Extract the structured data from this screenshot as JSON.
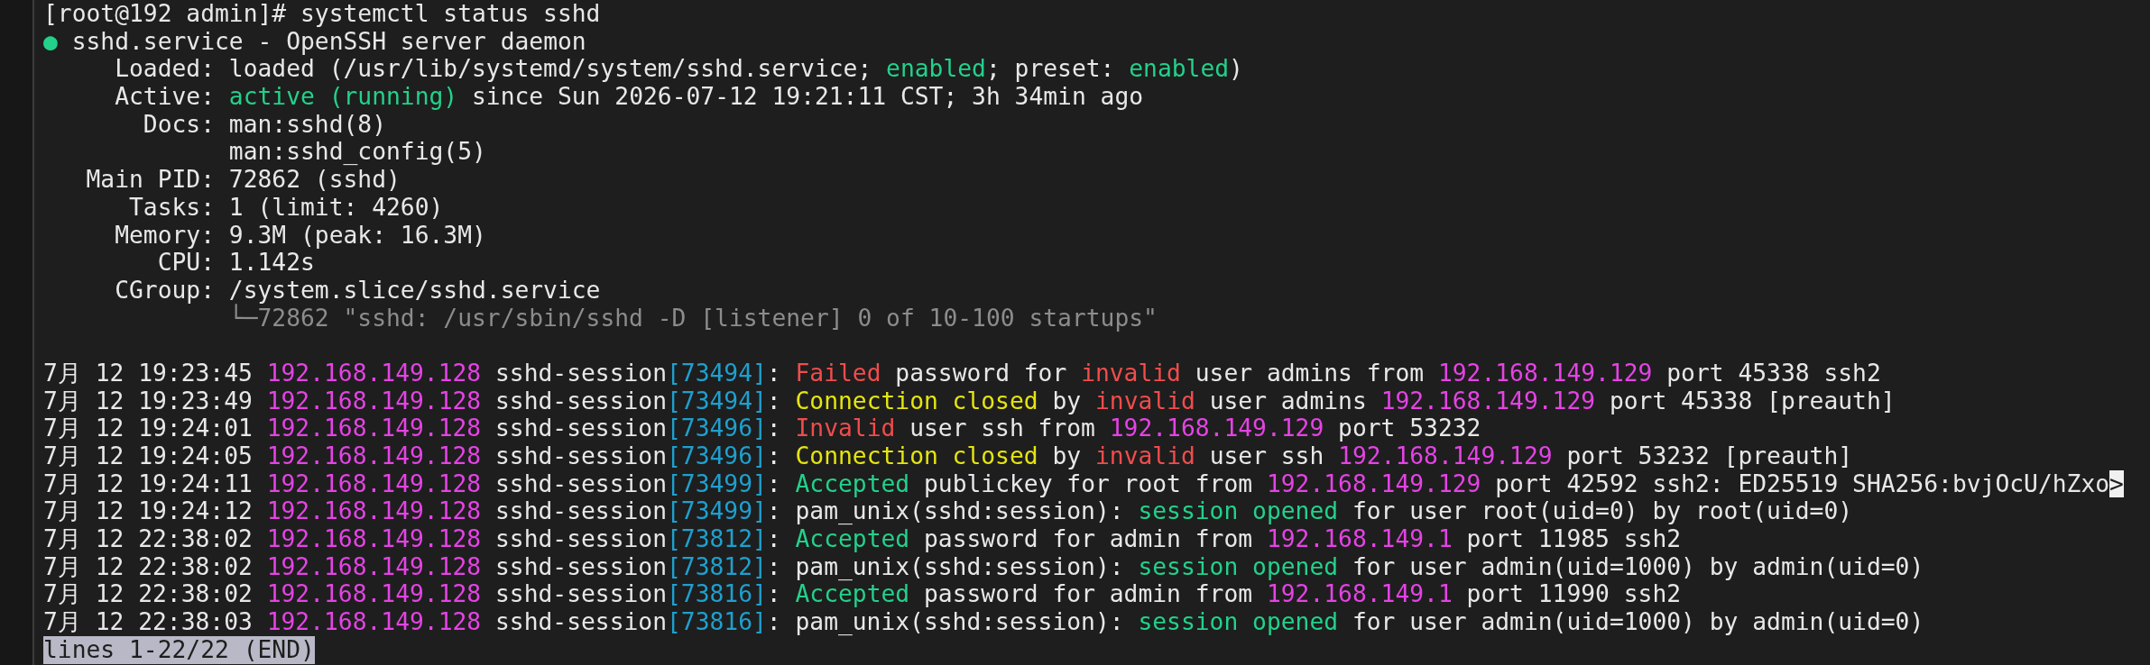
{
  "terminal": {
    "lines": [
      [
        {
          "text": "[root@192 admin]# systemctl status sshd",
          "kind": "plain"
        }
      ],
      [
        {
          "text": "●",
          "kind": "ok"
        },
        {
          "text": " sshd.service - OpenSSH server daemon",
          "kind": "plain"
        }
      ],
      [
        {
          "text": "     Loaded: loaded (/usr/lib/systemd/system/sshd.service; ",
          "kind": "plain"
        },
        {
          "text": "enabled",
          "kind": "ok"
        },
        {
          "text": "; preset: ",
          "kind": "plain"
        },
        {
          "text": "enabled",
          "kind": "ok"
        },
        {
          "text": ")",
          "kind": "plain"
        }
      ],
      [
        {
          "text": "     Active: ",
          "kind": "plain"
        },
        {
          "text": "active (running)",
          "kind": "ok"
        },
        {
          "text": " since Sun 2026-07-12 19:21:11 CST; 3h 34min ago",
          "kind": "plain"
        }
      ],
      [
        {
          "text": "       Docs: man:sshd(8)",
          "kind": "plain"
        }
      ],
      [
        {
          "text": "             man:sshd_config(5)",
          "kind": "plain"
        }
      ],
      [
        {
          "text": "   Main PID: 72862 (sshd)",
          "kind": "plain"
        }
      ],
      [
        {
          "text": "      Tasks: 1 (limit: 4260)",
          "kind": "plain"
        }
      ],
      [
        {
          "text": "     Memory: 9.3M (peak: 16.3M)",
          "kind": "plain"
        }
      ],
      [
        {
          "text": "        CPU: 1.142s",
          "kind": "plain"
        }
      ],
      [
        {
          "text": "     CGroup: /system.slice/sshd.service",
          "kind": "plain"
        }
      ],
      [
        {
          "text": "             └─72862 \"sshd: /usr/sbin/sshd -D [listener] 0 of 10-100 startups\"",
          "kind": "dim"
        }
      ]
    ],
    "journal": [
      [
        {
          "text": "7月 12 19:23:45 ",
          "kind": "plain"
        },
        {
          "text": "192.168.149.128",
          "kind": "address"
        },
        {
          "text": " sshd-session",
          "kind": "plain"
        },
        {
          "text": "[73494]",
          "kind": "pid"
        },
        {
          "text": ": ",
          "kind": "plain"
        },
        {
          "text": "Failed",
          "kind": "error"
        },
        {
          "text": " password for ",
          "kind": "plain"
        },
        {
          "text": "invalid",
          "kind": "error"
        },
        {
          "text": " user admins from ",
          "kind": "plain"
        },
        {
          "text": "192.168.149.129",
          "kind": "address"
        },
        {
          "text": " port 45338 ssh2",
          "kind": "plain"
        }
      ],
      [
        {
          "text": "7月 12 19:23:49 ",
          "kind": "plain"
        },
        {
          "text": "192.168.149.128",
          "kind": "address"
        },
        {
          "text": " sshd-session",
          "kind": "plain"
        },
        {
          "text": "[73494]",
          "kind": "pid"
        },
        {
          "text": ": ",
          "kind": "plain"
        },
        {
          "text": "Connection closed",
          "kind": "warn"
        },
        {
          "text": " by ",
          "kind": "plain"
        },
        {
          "text": "invalid",
          "kind": "error"
        },
        {
          "text": " user admins ",
          "kind": "plain"
        },
        {
          "text": "192.168.149.129",
          "kind": "address"
        },
        {
          "text": " port 45338 [preauth]",
          "kind": "plain"
        }
      ],
      [
        {
          "text": "7月 12 19:24:01 ",
          "kind": "plain"
        },
        {
          "text": "192.168.149.128",
          "kind": "address"
        },
        {
          "text": " sshd-session",
          "kind": "plain"
        },
        {
          "text": "[73496]",
          "kind": "pid"
        },
        {
          "text": ": ",
          "kind": "plain"
        },
        {
          "text": "Invalid",
          "kind": "error"
        },
        {
          "text": " user ssh from ",
          "kind": "plain"
        },
        {
          "text": "192.168.149.129",
          "kind": "address"
        },
        {
          "text": " port 53232",
          "kind": "plain"
        }
      ],
      [
        {
          "text": "7月 12 19:24:05 ",
          "kind": "plain"
        },
        {
          "text": "192.168.149.128",
          "kind": "address"
        },
        {
          "text": " sshd-session",
          "kind": "plain"
        },
        {
          "text": "[73496]",
          "kind": "pid"
        },
        {
          "text": ": ",
          "kind": "plain"
        },
        {
          "text": "Connection closed",
          "kind": "warn"
        },
        {
          "text": " by ",
          "kind": "plain"
        },
        {
          "text": "invalid",
          "kind": "error"
        },
        {
          "text": " user ssh ",
          "kind": "plain"
        },
        {
          "text": "192.168.149.129",
          "kind": "address"
        },
        {
          "text": " port 53232 [preauth]",
          "kind": "plain"
        }
      ],
      [
        {
          "text": "7月 12 19:24:11 ",
          "kind": "plain"
        },
        {
          "text": "192.168.149.128",
          "kind": "address"
        },
        {
          "text": " sshd-session",
          "kind": "plain"
        },
        {
          "text": "[73499]",
          "kind": "pid"
        },
        {
          "text": ": ",
          "kind": "plain"
        },
        {
          "text": "Accepted",
          "kind": "ok"
        },
        {
          "text": " publickey for root from ",
          "kind": "plain"
        },
        {
          "text": "192.168.149.129",
          "kind": "address"
        },
        {
          "text": " port 42592 ssh2: ED25519 SHA256:bvjOcU/hZxo",
          "kind": "plain"
        },
        {
          "text": ">",
          "kind": "reverse"
        }
      ],
      [
        {
          "text": "7月 12 19:24:12 ",
          "kind": "plain"
        },
        {
          "text": "192.168.149.128",
          "kind": "address"
        },
        {
          "text": " sshd-session",
          "kind": "plain"
        },
        {
          "text": "[73499]",
          "kind": "pid"
        },
        {
          "text": ": pam_unix(sshd:session): ",
          "kind": "plain"
        },
        {
          "text": "session opened",
          "kind": "ok"
        },
        {
          "text": " for user root(uid=0) by root(uid=0)",
          "kind": "plain"
        }
      ],
      [
        {
          "text": "7月 12 22:38:02 ",
          "kind": "plain"
        },
        {
          "text": "192.168.149.128",
          "kind": "address"
        },
        {
          "text": " sshd-session",
          "kind": "plain"
        },
        {
          "text": "[73812]",
          "kind": "pid"
        },
        {
          "text": ": ",
          "kind": "plain"
        },
        {
          "text": "Accepted",
          "kind": "ok"
        },
        {
          "text": " password for admin from ",
          "kind": "plain"
        },
        {
          "text": "192.168.149.1",
          "kind": "address"
        },
        {
          "text": " port 11985 ssh2",
          "kind": "plain"
        }
      ],
      [
        {
          "text": "7月 12 22:38:02 ",
          "kind": "plain"
        },
        {
          "text": "192.168.149.128",
          "kind": "address"
        },
        {
          "text": " sshd-session",
          "kind": "plain"
        },
        {
          "text": "[73812]",
          "kind": "pid"
        },
        {
          "text": ": pam_unix(sshd:session): ",
          "kind": "plain"
        },
        {
          "text": "session opened",
          "kind": "ok"
        },
        {
          "text": " for user admin(uid=1000) by admin(uid=0)",
          "kind": "plain"
        }
      ],
      [
        {
          "text": "7月 12 22:38:02 ",
          "kind": "plain"
        },
        {
          "text": "192.168.149.128",
          "kind": "address"
        },
        {
          "text": " sshd-session",
          "kind": "plain"
        },
        {
          "text": "[73816]",
          "kind": "pid"
        },
        {
          "text": ": ",
          "kind": "plain"
        },
        {
          "text": "Accepted",
          "kind": "ok"
        },
        {
          "text": " password for admin from ",
          "kind": "plain"
        },
        {
          "text": "192.168.149.1",
          "kind": "address"
        },
        {
          "text": " port 11990 ssh2",
          "kind": "plain"
        }
      ],
      [
        {
          "text": "7月 12 22:38:03 ",
          "kind": "plain"
        },
        {
          "text": "192.168.149.128",
          "kind": "address"
        },
        {
          "text": " sshd-session",
          "kind": "plain"
        },
        {
          "text": "[73816]",
          "kind": "pid"
        },
        {
          "text": ": pam_unix(sshd:session): ",
          "kind": "plain"
        },
        {
          "text": "session opened",
          "kind": "ok"
        },
        {
          "text": " for user admin(uid=1000) by admin(uid=0)",
          "kind": "plain"
        }
      ]
    ],
    "status_bar": "lines 1-22/22 (END)"
  }
}
